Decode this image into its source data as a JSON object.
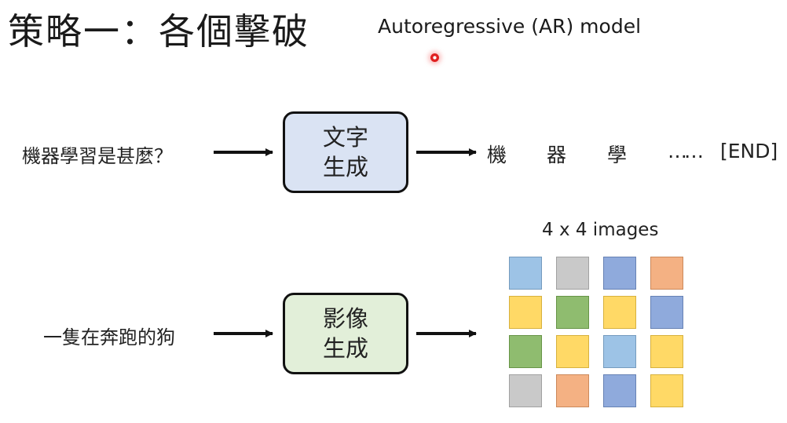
{
  "slide": {
    "title": "策略一：各個擊破",
    "subtitle": "Autoregressive (AR) model"
  },
  "text_generation": {
    "input": "機器學習是甚麼？",
    "box_line1": "文字",
    "box_line2": "生成",
    "output_tokens": [
      "機",
      "器",
      "學",
      "……",
      "[END]"
    ]
  },
  "image_generation": {
    "input": "一隻在奔跑的狗",
    "box_line1": "影像",
    "box_line2": "生成",
    "grid_title": "4 x 4 images",
    "grid_colors": [
      [
        "#9dc3e6",
        "#c9c9c9",
        "#8faadc",
        "#f4b183"
      ],
      [
        "#ffd966",
        "#8fbc6f",
        "#ffd966",
        "#8faadc"
      ],
      [
        "#8fbc6f",
        "#ffd966",
        "#9dc3e6",
        "#ffd966"
      ],
      [
        "#c9c9c9",
        "#f4b183",
        "#8faadc",
        "#ffd966"
      ]
    ]
  },
  "colors": {
    "text_box_fill": "#dae3f3",
    "image_box_fill": "#e2efd9",
    "pointer": "#e02020"
  }
}
